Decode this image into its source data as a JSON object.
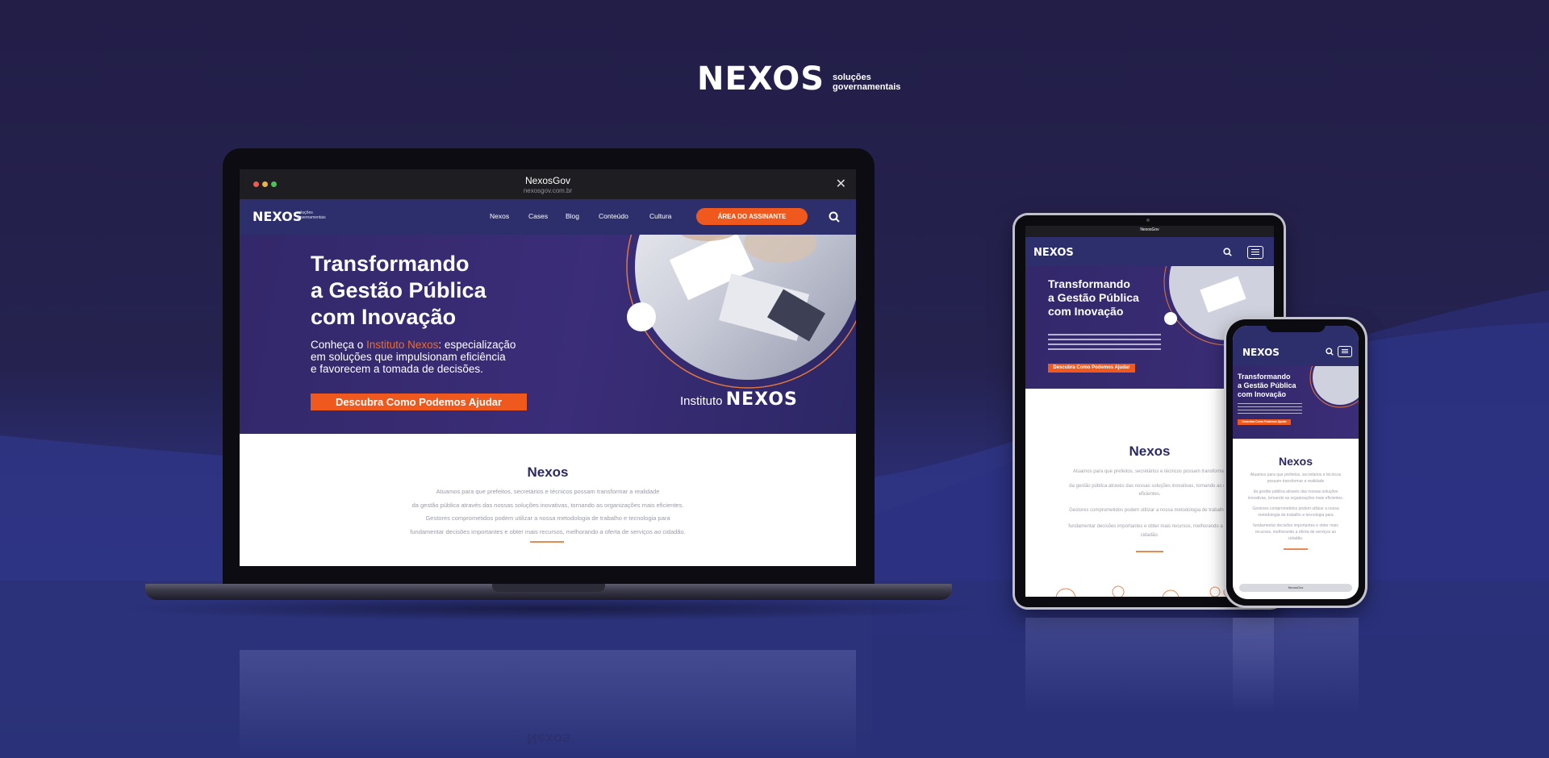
{
  "brand": {
    "name": "NEXOS",
    "tagline_line1": "soluções",
    "tagline_line2": "governamentais"
  },
  "colors": {
    "accent": "#f0591e",
    "navy": "#2d2f6d",
    "purple": "#3b2d78",
    "background": "#221e48"
  },
  "browser": {
    "title": "NexosGov",
    "url": "nexosgov.com.br",
    "close_icon": "close-icon"
  },
  "site": {
    "logo": "NEXOS",
    "logo_tag_line1": "soluções",
    "logo_tag_line2": "governamentais",
    "nav": [
      "Nexos",
      "Cases",
      "Blog",
      "Conteúdo",
      "Cultura"
    ],
    "cta": "ÁREA DO ASSINANTE",
    "search_icon": "search-icon",
    "hero": {
      "title_line1": "Transformando",
      "title_line2": "a Gestão Pública",
      "title_line3": "com Inovação",
      "sub_pre": "Conheça o ",
      "sub_highlight": "Instituto Nexos",
      "sub_post": ": especialização",
      "sub_line2": "em soluções que impulsionam eficiência",
      "sub_line3": "e favorecem a tomada de decisões.",
      "button": "Descubra Como Podemos Ajudar",
      "institute_prefix": "Instituto",
      "institute_name": "NEXOS"
    },
    "about": {
      "heading": "Nexos",
      "lines": [
        "Atuamos para que prefeitos, secretários e técnicos possam transformar a realidade",
        "da gestão pública através das nossas soluções inovativas, tornando as organizações mais eficientes.",
        "Gestores comprometidos podem utilizar a nossa metodologia de trabalho e tecnologia para",
        "fundamentar decisões importantes e obter mais recursos, melhorando a oferta de serviços ao cidadão."
      ]
    }
  },
  "tablet": {
    "title": "NexosGov",
    "hero_line1": "Transformando",
    "hero_line2": "a Gestão Pública",
    "hero_line3": "com Inovação",
    "button": "Descubra Como Podemos Ajudar",
    "heading": "Nexos",
    "lines": [
      "Atuamos para que prefeitos, secretários e técnicos possam transformar",
      "da gestão pública através das nossas soluções inovativas, tornando as org",
      "eficientes.",
      "Gestores comprometidos podem utilizar a nossa metodologia de trabalho e",
      "fundamentar decisões importantes e obter mais recursos, melhorando a ofe",
      "cidadão."
    ]
  },
  "phone": {
    "hero_line1": "Transformando",
    "hero_line2": "a Gestão Pública",
    "hero_line3": "com Inovação",
    "button": "Descubra Como Podemos Ajudar",
    "heading": "Nexos",
    "lines": [
      "Atuamos para que prefeitos, secretários e técnicos",
      "possam transformar a realidade",
      "da gestão pública através das nossas soluções",
      "inovativas, tornando as organizações mais eficientes.",
      "Gestores comprometidos podem utilizar a nossa",
      "metodologia de trabalho e tecnologia para",
      "fundamentar decisões importantes e obter mais",
      "recursos, melhorando a oferta de serviços ao",
      "cidadão."
    ],
    "url": "NexosGov"
  }
}
